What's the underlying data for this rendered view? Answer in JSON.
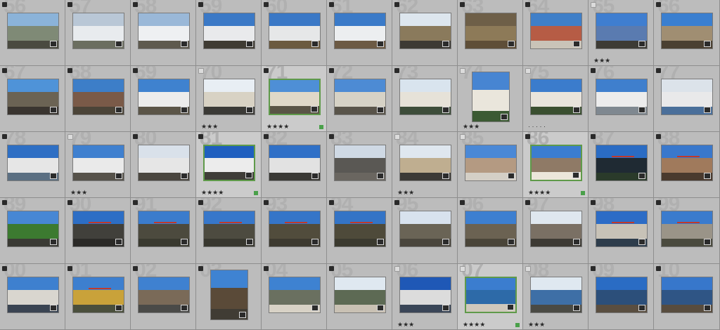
{
  "cells": [
    {
      "n": "56",
      "flag": "on",
      "sky": "#8bb3d9",
      "mid": "#7f8a76",
      "ground": "#4a4a40",
      "stars": "",
      "portrait": false
    },
    {
      "n": "57",
      "flag": "on",
      "sky": "#b9c7d6",
      "mid": "#e8ebee",
      "ground": "#6b6e60",
      "stars": "",
      "portrait": false
    },
    {
      "n": "58",
      "flag": "on",
      "sky": "#9ab8d8",
      "mid": "#eef0f2",
      "ground": "#5e5a4e",
      "stars": "",
      "portrait": false
    },
    {
      "n": "59",
      "flag": "on",
      "sky": "#3b79c6",
      "mid": "#e9eaec",
      "ground": "#3f3b33",
      "stars": "",
      "portrait": false
    },
    {
      "n": "60",
      "flag": "on",
      "sky": "#3a78c6",
      "mid": "#e6e7e8",
      "ground": "#6b5a3f",
      "stars": "",
      "portrait": false
    },
    {
      "n": "61",
      "flag": "on",
      "sky": "#3a7ac8",
      "mid": "#eceef0",
      "ground": "#6c5a44",
      "stars": "",
      "portrait": false
    },
    {
      "n": "62",
      "flag": "on",
      "sky": "#dde6ee",
      "mid": "#8a7a5c",
      "ground": "#3d3a34",
      "stars": "",
      "portrait": false
    },
    {
      "n": "63",
      "flag": "on",
      "sky": "#6e5f48",
      "mid": "#8d7a58",
      "ground": "#5e4e38",
      "stars": "",
      "portrait": false
    },
    {
      "n": "64",
      "flag": "on",
      "sky": "#3f7fc8",
      "mid": "#b65c45",
      "ground": "#c9c3b8",
      "stars": "",
      "portrait": false
    },
    {
      "n": "65",
      "flag": "off",
      "sky": "#3f7ed0",
      "mid": "#5a7bb0",
      "ground": "#3d3b35",
      "stars": "★★★",
      "portrait": false
    },
    {
      "n": "66",
      "flag": "on",
      "sky": "#3a7fd0",
      "mid": "#a08e72",
      "ground": "#4a4032",
      "stars": "",
      "portrait": false
    },
    {
      "n": "67",
      "flag": "on",
      "sky": "#4f93d8",
      "mid": "#6b6354",
      "ground": "#3a3530",
      "stars": "",
      "portrait": false
    },
    {
      "n": "68",
      "flag": "on",
      "sky": "#3d7ec8",
      "mid": "#7a5a48",
      "ground": "#4b4438",
      "stars": "",
      "portrait": false
    },
    {
      "n": "69",
      "flag": "on",
      "sky": "#3f82cf",
      "mid": "#ececec",
      "ground": "#5b5548",
      "stars": "",
      "portrait": false
    },
    {
      "n": "70",
      "flag": "off",
      "sky": "#e8eef4",
      "mid": "#d8d2c4",
      "ground": "#3b3a36",
      "stars": "★★★",
      "portrait": false
    },
    {
      "n": "71",
      "flag": "on",
      "sky": "#4e8fd6",
      "mid": "#dfd8c8",
      "ground": "#5a5446",
      "stars": "★★★★",
      "portrait": false,
      "picked": true
    },
    {
      "n": "72",
      "flag": "on",
      "sky": "#4d8bd4",
      "mid": "#d6d2c6",
      "ground": "#59544a",
      "stars": "",
      "portrait": false
    },
    {
      "n": "73",
      "flag": "on",
      "sky": "#d9e4ee",
      "mid": "#e6e2d8",
      "ground": "#3d4d3a",
      "stars": "",
      "portrait": false
    },
    {
      "n": "74",
      "flag": "off",
      "sky": "#4785d2",
      "mid": "#eae6dc",
      "ground": "#3b5a33",
      "stars": "★★★",
      "portrait": true
    },
    {
      "n": "75",
      "flag": "off",
      "sky": "#3b7ccc",
      "mid": "#e8e4dc",
      "ground": "#3a4f30",
      "stars": "· · · · ·",
      "portrait": false
    },
    {
      "n": "76",
      "flag": "on",
      "sky": "#3f7fcd",
      "mid": "#ececec",
      "ground": "#7f8890",
      "stars": "",
      "portrait": false
    },
    {
      "n": "77",
      "flag": "on",
      "sky": "#dce3ea",
      "mid": "#e9e9ea",
      "ground": "#4a6f9a",
      "stars": "",
      "portrait": false
    },
    {
      "n": "78",
      "flag": "on",
      "sky": "#2e6fc4",
      "mid": "#e6e6e6",
      "ground": "#5b6f82",
      "stars": "",
      "portrait": false
    },
    {
      "n": "79",
      "flag": "off",
      "sky": "#3f80cf",
      "mid": "#eaeaea",
      "ground": "#56524a",
      "stars": "★★★",
      "portrait": false
    },
    {
      "n": "80",
      "flag": "on",
      "sky": "#d9e1ea",
      "mid": "#e6e6e6",
      "ground": "#4a463f",
      "stars": "",
      "portrait": false
    },
    {
      "n": "81",
      "flag": "on",
      "sky": "#1f5fbf",
      "mid": "#ececec",
      "ground": "#3f3d38",
      "stars": "★★★★",
      "portrait": false,
      "picked": true
    },
    {
      "n": "82",
      "flag": "on",
      "sky": "#2f70c7",
      "mid": "#e2e2e2",
      "ground": "#3a3935",
      "stars": "",
      "portrait": false
    },
    {
      "n": "83",
      "flag": "on",
      "sky": "#cfd9e4",
      "mid": "#5a5854",
      "ground": "#6a6660",
      "stars": "",
      "portrait": false
    },
    {
      "n": "84",
      "flag": "off",
      "sky": "#dfe7ef",
      "mid": "#bfae90",
      "ground": "#3c3a36",
      "stars": "★★★",
      "portrait": false
    },
    {
      "n": "85",
      "flag": "off",
      "sky": "#4a88d6",
      "mid": "#b49a82",
      "ground": "#d4cfc6",
      "stars": "",
      "portrait": false
    },
    {
      "n": "86",
      "flag": "on",
      "sky": "#3b7dd0",
      "mid": "#8f7a66",
      "ground": "#ece6da",
      "stars": "★★★★",
      "portrait": false,
      "picked": true
    },
    {
      "n": "87",
      "flag": "on",
      "sky": "#2a6cc4",
      "mid": "#1f2a33",
      "ground": "#2a3a2a",
      "stars": "",
      "portrait": false,
      "crane": true
    },
    {
      "n": "88",
      "flag": "on",
      "sky": "#3978cc",
      "mid": "#a07a5c",
      "ground": "#4a3a2e",
      "stars": "",
      "portrait": false,
      "crane": true
    },
    {
      "n": "89",
      "flag": "on",
      "sky": "#4787d4",
      "mid": "#3c7a30",
      "ground": "#3a3a34",
      "stars": "",
      "portrait": false
    },
    {
      "n": "90",
      "flag": "on",
      "sky": "#2d6ec5",
      "mid": "#41403b",
      "ground": "#2b2a27",
      "stars": "",
      "portrait": false,
      "crane": true
    },
    {
      "n": "91",
      "flag": "on",
      "sky": "#3b7ccc",
      "mid": "#4c4a3e",
      "ground": "#3a3a30",
      "stars": "",
      "portrait": false,
      "crane": true
    },
    {
      "n": "92",
      "flag": "on",
      "sky": "#3777ca",
      "mid": "#4d4b40",
      "ground": "#38372f",
      "stars": "",
      "portrait": false,
      "crane": true
    },
    {
      "n": "93",
      "flag": "on",
      "sky": "#3575c8",
      "mid": "#514c3c",
      "ground": "#3d3a30",
      "stars": "",
      "portrait": false,
      "crane": true
    },
    {
      "n": "94",
      "flag": "on",
      "sky": "#3474c6",
      "mid": "#4e4a3a",
      "ground": "#3b3a2f",
      "stars": "",
      "portrait": false,
      "crane": true
    },
    {
      "n": "95",
      "flag": "on",
      "sky": "#d8e2ee",
      "mid": "#6a6456",
      "ground": "#4a463d",
      "stars": "",
      "portrait": false
    },
    {
      "n": "96",
      "flag": "on",
      "sky": "#3d7fd0",
      "mid": "#6b6252",
      "ground": "#4a4539",
      "stars": "",
      "portrait": false
    },
    {
      "n": "97",
      "flag": "on",
      "sky": "#dfe7ef",
      "mid": "#7a7064",
      "ground": "#3d3a34",
      "stars": "",
      "portrait": false
    },
    {
      "n": "98",
      "flag": "on",
      "sky": "#2c6cc6",
      "mid": "#c7c2b7",
      "ground": "#2e3d4c",
      "stars": "",
      "portrait": false,
      "crane": true
    },
    {
      "n": "99",
      "flag": "on",
      "sky": "#3a7bcd",
      "mid": "#9a9488",
      "ground": "#4a4a3e",
      "stars": "",
      "portrait": false,
      "crane": true
    },
    {
      "n": "00",
      "flag": "on",
      "sky": "#3e80cf",
      "mid": "#d9d6cf",
      "ground": "#3a4452",
      "stars": "",
      "portrait": false
    },
    {
      "n": "01",
      "flag": "on",
      "sky": "#3d7fcf",
      "mid": "#c9a23a",
      "ground": "#4a4f3c",
      "stars": "",
      "portrait": false,
      "crane": true
    },
    {
      "n": "02",
      "flag": "on",
      "sky": "#3f81d0",
      "mid": "#7a6a58",
      "ground": "#4a4a48",
      "stars": "",
      "portrait": false
    },
    {
      "n": "03",
      "flag": "on",
      "sky": "#3f83d2",
      "mid": "#5a4a38",
      "ground": "#403c34",
      "stars": "",
      "portrait": true
    },
    {
      "n": "04",
      "flag": "on",
      "sky": "#3e82d1",
      "mid": "#6a7060",
      "ground": "#d8d2c6",
      "stars": "",
      "portrait": false
    },
    {
      "n": "05",
      "flag": "on",
      "sky": "#dfe8f0",
      "mid": "#5d6a54",
      "ground": "#c9c1b4",
      "stars": "",
      "portrait": false
    },
    {
      "n": "06",
      "flag": "off",
      "sky": "#1f58b6",
      "mid": "#dcdcdc",
      "ground": "#3a4658",
      "stars": "★★★",
      "portrait": false
    },
    {
      "n": "07",
      "flag": "off",
      "sky": "#3b7dcf",
      "mid": "#2d6aa8",
      "ground": "#cfc8bc",
      "stars": "★★★★",
      "portrait": false,
      "picked": true
    },
    {
      "n": "08",
      "flag": "off",
      "sky": "#dfe8f0",
      "mid": "#3e6fa6",
      "ground": "#4a4a44",
      "stars": "★★★",
      "portrait": false
    },
    {
      "n": "09",
      "flag": "on",
      "sky": "#2a6cc4",
      "mid": "#2c4f7a",
      "ground": "#5a4e40",
      "stars": "",
      "portrait": false
    },
    {
      "n": "10",
      "flag": "on",
      "sky": "#3777cb",
      "mid": "#2f5585",
      "ground": "#584c3e",
      "stars": "",
      "portrait": false
    }
  ]
}
